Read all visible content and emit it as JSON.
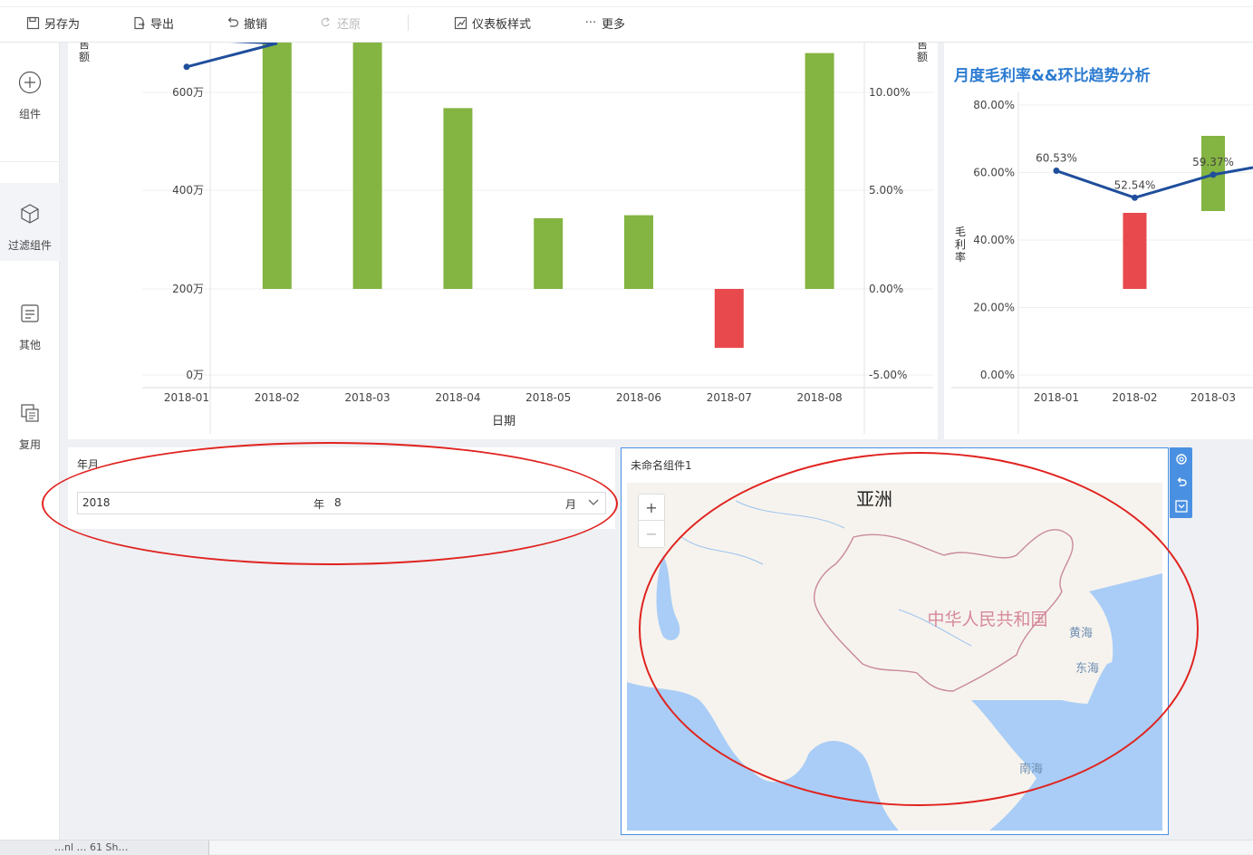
{
  "toolbar": {
    "save_as": "另存为",
    "export": "导出",
    "undo": "撤销",
    "redo": "还原",
    "dashboard_style": "仪表板样式",
    "more": "更多"
  },
  "sidebar": {
    "items": [
      {
        "label": "组件",
        "icon": "plus-circle-icon"
      },
      {
        "label": "过滤组件",
        "icon": "cube-icon"
      },
      {
        "label": "其他",
        "icon": "document-icon"
      },
      {
        "label": "复用",
        "icon": "copy-icon"
      }
    ]
  },
  "main_chart": {
    "y_left_label": "售\n额",
    "y_right_label": "售\n额",
    "x_label": "日期"
  },
  "right_chart": {
    "title": "月度毛利率&&环比趋势分析",
    "y_label": "毛\n利\n率"
  },
  "chart_data": [
    {
      "type": "bar",
      "categories": [
        "2018-01",
        "2018-02",
        "2018-03",
        "2018-04",
        "2018-05",
        "2018-06",
        "2018-07",
        "2018-08"
      ],
      "xlabel": "日期",
      "ylabel": "售额",
      "y_left_ticks": [
        "0万",
        "200万",
        "400万",
        "600万"
      ],
      "y_right_ticks": [
        "-5.00%",
        "0.00%",
        "5.00%",
        "10.00%"
      ],
      "y_right_range": [
        -5,
        12.5
      ],
      "series": [
        {
          "type": "bar",
          "values": [
            null,
            16,
            16,
            9.2,
            3.6,
            3.75,
            -3.0,
            12.0
          ],
          "unit": "%"
        },
        {
          "type": "line",
          "values": [
            11.3,
            12.5
          ]
        }
      ],
      "grid": true
    },
    {
      "type": "bar",
      "categories": [
        "2018-01",
        "2018-02",
        "2018-03"
      ],
      "ylabel": "毛利率",
      "y_ticks": [
        "0.00%",
        "20.00%",
        "40.00%",
        "60.00%",
        "80.00%"
      ],
      "ylim": [
        0,
        80
      ],
      "series": [
        {
          "type": "line",
          "values": [
            60.53,
            52.54,
            59.37
          ],
          "labels": [
            "60.53%",
            "52.54%",
            "59.37%"
          ]
        },
        {
          "type": "bar",
          "values": [
            null,
            -8.0,
            6.8
          ]
        }
      ],
      "grid": true
    }
  ],
  "filter": {
    "label": "年月",
    "year": "2018",
    "year_unit": "年",
    "month": "8",
    "month_unit": "月"
  },
  "map": {
    "title": "未命名组件1",
    "labels": {
      "asia": "亚洲",
      "china": "中华人民共和国",
      "yellow_sea": "黄海",
      "east_sea": "东海",
      "south_sea": "南海"
    },
    "zoom_in": "+",
    "zoom_out": "−"
  },
  "bottom_tab": {
    "label": "…nl … 61 Sh…"
  },
  "colors": {
    "bar_green": "#84b441",
    "bar_red": "#e8494d",
    "line_blue": "#1f4e9c",
    "title_blue": "#2b7bd1",
    "annotation_red": "#e0231f"
  }
}
